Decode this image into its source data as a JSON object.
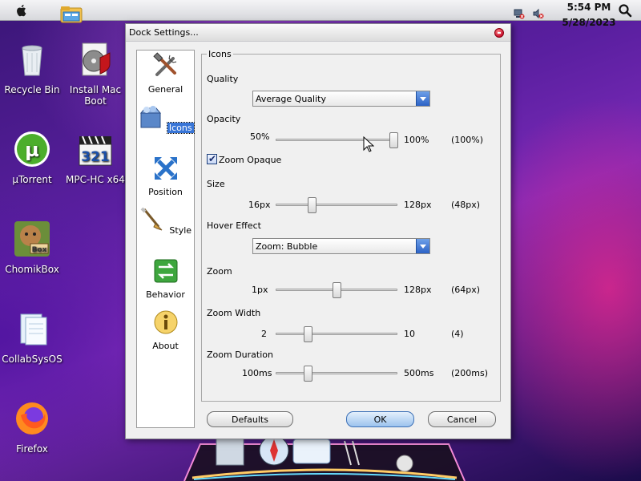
{
  "menubar": {
    "time": "5:54 PM",
    "date": "5/28/2023"
  },
  "desktop": {
    "icons": [
      {
        "label": "Recycle Bin"
      },
      {
        "label": "Install Mac Boot"
      },
      {
        "label": "µTorrent"
      },
      {
        "label": "MPC-HC x64"
      },
      {
        "label": "ChomikBox"
      },
      {
        "label": "CollabSysOS"
      },
      {
        "label": "Firefox"
      }
    ]
  },
  "dialog": {
    "title": "Dock Settings...",
    "nav": [
      {
        "label": "General",
        "icon": "tools-icon"
      },
      {
        "label": "Icons",
        "icon": "icons-box-icon",
        "active": true
      },
      {
        "label": "Position",
        "icon": "position-arrows-icon"
      },
      {
        "label": "Style",
        "icon": "paintbrush-icon"
      },
      {
        "label": "Behavior",
        "icon": "behavior-arrows-icon"
      },
      {
        "label": "About",
        "icon": "info-icon"
      }
    ],
    "panel": {
      "legend": "Icons",
      "quality": {
        "label": "Quality",
        "value": "Average Quality"
      },
      "opacity": {
        "label": "Opacity",
        "min": "50%",
        "max": "100%",
        "current": "(100%)",
        "level": 0.97
      },
      "zoom_opaque": {
        "label": "Zoom Opaque",
        "checked": true
      },
      "size": {
        "label": "Size",
        "min": "16px",
        "max": "128px",
        "current": "(48px)",
        "level": 0.29
      },
      "hover_effect": {
        "label": "Hover Effect",
        "value": "Zoom: Bubble"
      },
      "zoom": {
        "label": "Zoom",
        "min": "1px",
        "max": "128px",
        "current": "(64px)",
        "level": 0.5
      },
      "zoom_width": {
        "label": "Zoom Width",
        "min": "2",
        "max": "10",
        "current": "(4)",
        "level": 0.26
      },
      "zoom_duration": {
        "label": "Zoom Duration",
        "min": "100ms",
        "max": "500ms",
        "current": "(200ms)",
        "level": 0.26
      }
    },
    "buttons": {
      "defaults": "Defaults",
      "ok": "OK",
      "cancel": "Cancel"
    }
  }
}
